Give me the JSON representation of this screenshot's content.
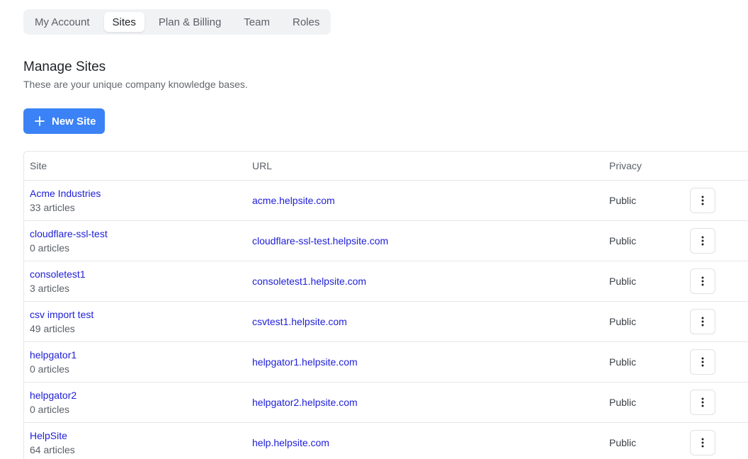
{
  "tabs": [
    {
      "label": "My Account",
      "active": false
    },
    {
      "label": "Sites",
      "active": true
    },
    {
      "label": "Plan & Billing",
      "active": false
    },
    {
      "label": "Team",
      "active": false
    },
    {
      "label": "Roles",
      "active": false
    }
  ],
  "page": {
    "title": "Manage Sites",
    "subtitle": "These are your unique company knowledge bases."
  },
  "new_site_button": {
    "label": "New Site",
    "icon": "plus-icon"
  },
  "table": {
    "headers": {
      "site": "Site",
      "url": "URL",
      "privacy": "Privacy"
    },
    "rows": [
      {
        "name": "Acme Industries",
        "count": "33 articles",
        "url": "acme.helpsite.com",
        "privacy": "Public"
      },
      {
        "name": "cloudflare-ssl-test",
        "count": "0 articles",
        "url": "cloudflare-ssl-test.helpsite.com",
        "privacy": "Public"
      },
      {
        "name": "consoletest1",
        "count": "3 articles",
        "url": "consoletest1.helpsite.com",
        "privacy": "Public"
      },
      {
        "name": "csv import test",
        "count": "49 articles",
        "url": "csvtest1.helpsite.com",
        "privacy": "Public"
      },
      {
        "name": "helpgator1",
        "count": "0 articles",
        "url": "helpgator1.helpsite.com",
        "privacy": "Public"
      },
      {
        "name": "helpgator2",
        "count": "0 articles",
        "url": "helpgator2.helpsite.com",
        "privacy": "Public"
      },
      {
        "name": "HelpSite",
        "count": "64 articles",
        "url": "help.helpsite.com",
        "privacy": "Public"
      }
    ],
    "row_action_icon": "vertical-dots-icon"
  },
  "colors": {
    "primary": "#3b82f6",
    "link": "#2020d8",
    "border": "#e4e6ea"
  }
}
